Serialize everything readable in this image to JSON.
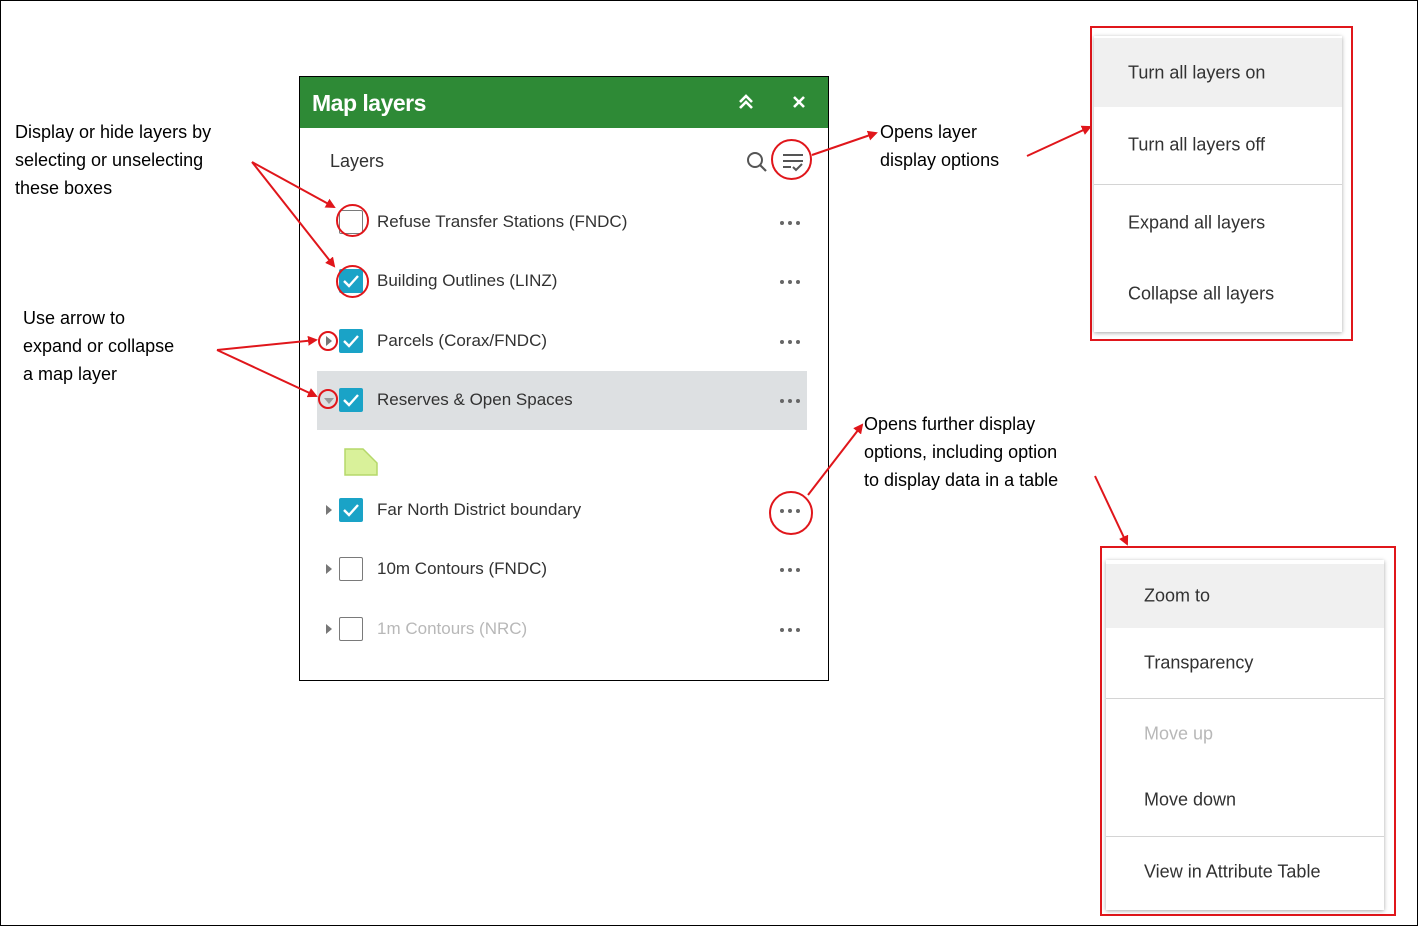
{
  "panel": {
    "title": "Map layers",
    "section_label": "Layers",
    "header_color": "#2e8a36",
    "checkbox_color": "#1aa3c7",
    "layers": [
      {
        "name": "Refuse Transfer Stations (FNDC)",
        "checked": false,
        "dimmed": false
      },
      {
        "name": "Building Outlines (LINZ)",
        "checked": true,
        "dimmed": false
      },
      {
        "name": "Parcels (Corax/FNDC)",
        "checked": true,
        "dimmed": false
      },
      {
        "name": "Reserves & Open Spaces",
        "checked": true,
        "dimmed": false,
        "expanded": true,
        "selected": true
      },
      {
        "name": "Far North District boundary",
        "checked": true,
        "dimmed": false
      },
      {
        "name": "10m Contours (FNDC)",
        "checked": false,
        "dimmed": false
      },
      {
        "name": "1m Contours (NRC)",
        "checked": false,
        "dimmed": true
      }
    ]
  },
  "annotations": {
    "checkbox_note": "Display or hide layers by\nselecting or unselecting\nthese boxes",
    "arrow_note": "Use arrow to\nexpand or collapse\na map layer",
    "options_note": "Opens layer\ndisplay options",
    "more_note": "Opens further display\noptions, including option\nto display data in a table",
    "accent_color": "#e0161b"
  },
  "layer_options_menu": {
    "items": [
      "Turn all layers on",
      "Turn all layers off",
      "Expand all layers",
      "Collapse all layers"
    ]
  },
  "layer_actions_menu": {
    "items": [
      "Zoom to",
      "Transparency",
      "Move up",
      "Move down",
      "View in Attribute Table"
    ]
  }
}
